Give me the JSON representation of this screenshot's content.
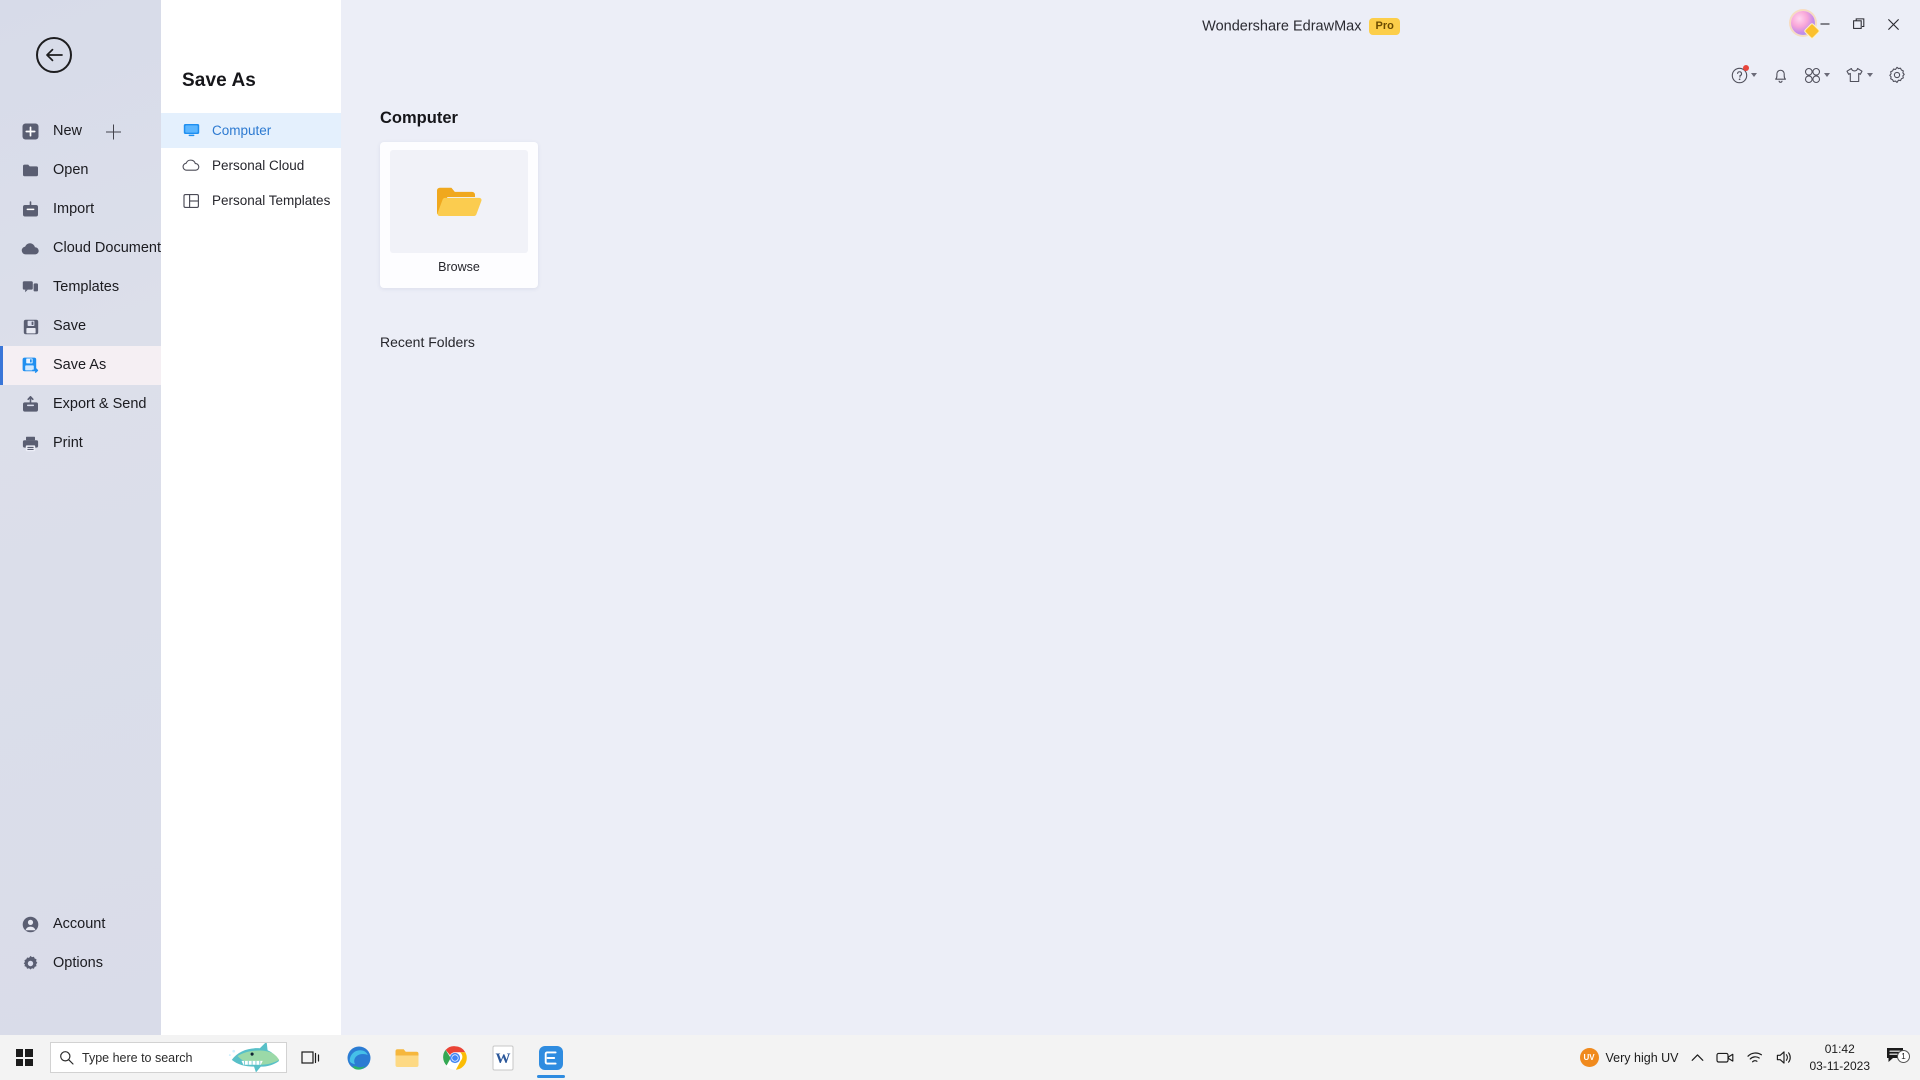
{
  "window": {
    "app_title": "Wondershare EdrawMax",
    "pro_badge": "Pro",
    "minimize_label": "Minimize",
    "maximize_label": "Restore",
    "close_label": "Close"
  },
  "top_toolbar": {
    "items": [
      {
        "name": "help-icon",
        "label": "Help",
        "has_caret": true,
        "has_dot": true
      },
      {
        "name": "bell-icon",
        "label": "Notifications",
        "has_caret": false,
        "has_dot": false
      },
      {
        "name": "apps-grid-icon",
        "label": "Apps",
        "has_caret": true,
        "has_dot": false
      },
      {
        "name": "theme-shirt-icon",
        "label": "Theme",
        "has_caret": true,
        "has_dot": false
      },
      {
        "name": "gear-icon",
        "label": "Settings",
        "has_caret": false,
        "has_dot": false
      }
    ],
    "avatar_label": "Account avatar"
  },
  "backstage": {
    "back_label": "Back",
    "items": [
      {
        "label": "New",
        "icon": "new-icon",
        "active": false,
        "plus": true
      },
      {
        "label": "Open",
        "icon": "folder-icon",
        "active": false
      },
      {
        "label": "Import",
        "icon": "import-icon",
        "active": false
      },
      {
        "label": "Cloud Documents",
        "icon": "cloud-icon",
        "active": false
      },
      {
        "label": "Templates",
        "icon": "templates-icon",
        "active": false
      },
      {
        "label": "Save",
        "icon": "save-icon",
        "active": false
      },
      {
        "label": "Save As",
        "icon": "save-as-icon",
        "active": true
      },
      {
        "label": "Export & Send",
        "icon": "export-icon",
        "active": false
      },
      {
        "label": "Print",
        "icon": "printer-icon",
        "active": false
      }
    ],
    "bottom_items": [
      {
        "label": "Account",
        "icon": "person-icon"
      },
      {
        "label": "Options",
        "icon": "gear-icon"
      }
    ]
  },
  "mid_panel": {
    "title": "Save As",
    "items": [
      {
        "label": "Computer",
        "icon": "monitor-icon",
        "active": true
      },
      {
        "label": "Personal Cloud",
        "icon": "cloud-icon",
        "active": false
      },
      {
        "label": "Personal Templates",
        "icon": "panels-icon",
        "active": false
      }
    ]
  },
  "main": {
    "heading": "Computer",
    "browse_label": "Browse",
    "browse_icon": "folder-open-icon",
    "recent_heading": "Recent Folders"
  },
  "taskbar": {
    "start_label": "Start",
    "search_placeholder": "Type here to search",
    "buttons": [
      {
        "name": "task-view-icon",
        "label": "Task View",
        "running": false
      },
      {
        "name": "edge-icon",
        "label": "Microsoft Edge",
        "running": false
      },
      {
        "name": "file-explorer-icon",
        "label": "File Explorer",
        "running": false
      },
      {
        "name": "chrome-icon",
        "label": "Google Chrome",
        "running": false
      },
      {
        "name": "word-icon",
        "label": "Microsoft Word",
        "running": false
      },
      {
        "name": "edrawmax-icon",
        "label": "Wondershare EdrawMax",
        "running": true
      }
    ],
    "tray": {
      "uv_badge": "UV",
      "uv_text": "Very high UV",
      "chevron_label": "Show hidden icons",
      "meet_label": "Meet Now",
      "network_label": "Network",
      "volume_label": "Volume",
      "time": "01:42",
      "date": "03-11-2023",
      "notification_count": "1"
    }
  },
  "colors": {
    "accent": "#2d7ad1",
    "app_bg": "#eceef7",
    "sidebar_bg": "#dadded",
    "panel_bg": "#ffffff",
    "pro_badge_bg": "#fcce4a",
    "active_mid": "#e4f0fd",
    "folder_yellow": "#f6c445"
  }
}
